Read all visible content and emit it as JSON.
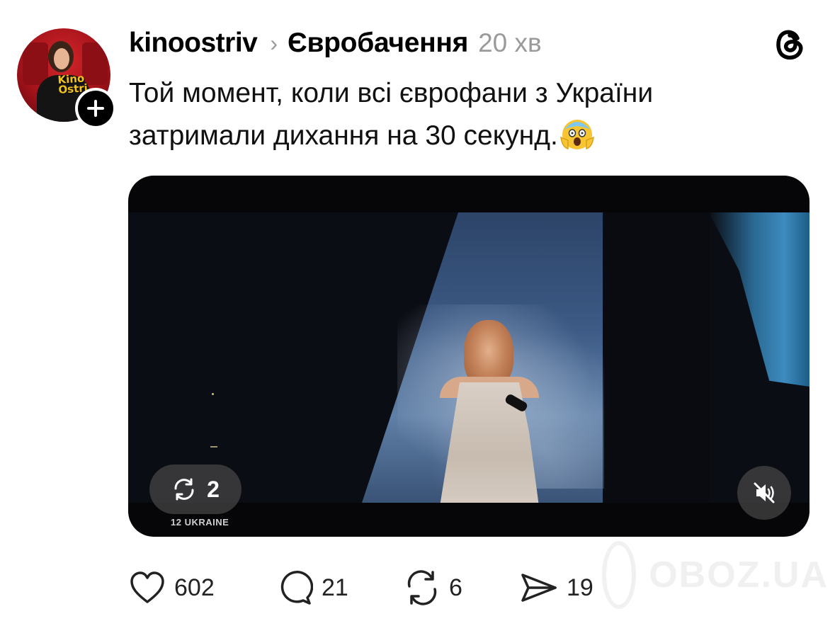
{
  "post": {
    "username": "kinoostriv",
    "topic": "Євробачення",
    "time": "20 хв",
    "text": "Той момент, коли всі єврофани з України затримали дихання на 30 секунд.",
    "avatar_logo": "Kino Ostriv"
  },
  "media": {
    "repost_count": "2",
    "caption": "12 UKRAINE"
  },
  "actions": {
    "likes": "602",
    "replies": "21",
    "reposts": "6",
    "shares": "19"
  },
  "watermark": "OBOZ.UA",
  "icons": {
    "threads": "threads-logo-icon",
    "follow": "plus-icon",
    "like": "heart-icon",
    "reply": "comment-icon",
    "repost": "repost-icon",
    "share": "send-icon",
    "mute": "speaker-muted-icon",
    "emoji": "screaming-face-emoji"
  }
}
